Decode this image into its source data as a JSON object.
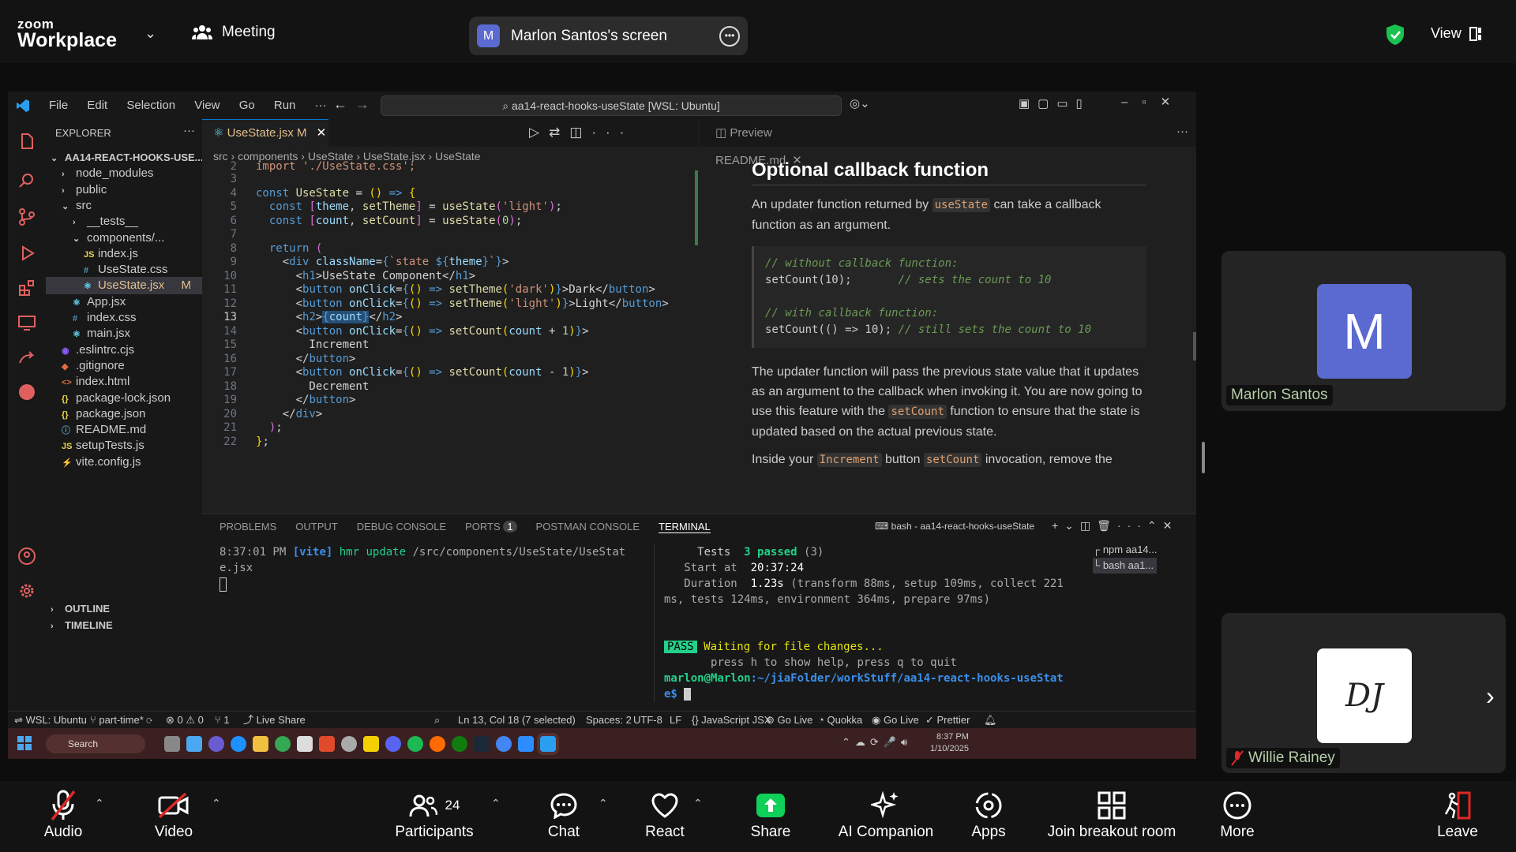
{
  "zoom": {
    "brand_top": "zoom",
    "brand_bottom": "Workplace",
    "meeting_label": "Meeting",
    "share_avatar": "M",
    "share_label": "Marlon Santos's screen",
    "view_label": "View",
    "participants_count": "24",
    "toolbar": {
      "audio": "Audio",
      "video": "Video",
      "participants": "Participants",
      "chat": "Chat",
      "react": "React",
      "share": "Share",
      "ai": "AI Companion",
      "apps": "Apps",
      "breakout": "Join breakout room",
      "more": "More",
      "leave": "Leave"
    },
    "tiles": [
      {
        "name": "Marlon Santos",
        "initial": "M"
      },
      {
        "name": "Willie Rainey",
        "initial": "DJ"
      }
    ],
    "colors": {
      "share_green": "#0fd058",
      "avatar_purple": "#5a6ad0",
      "leave_red": "#e02828"
    }
  },
  "vscode": {
    "menu": [
      "File",
      "Edit",
      "Selection",
      "View",
      "Go",
      "Run",
      "···"
    ],
    "command_center": "aa14-react-hooks-useState [WSL: Ubuntu]",
    "explorer_title": "EXPLORER",
    "tree": [
      {
        "label": "AA14-REACT-HOOKS-USE...",
        "icon": "⌄"
      },
      {
        "label": "node_modules",
        "icon": "›"
      },
      {
        "label": "public",
        "icon": "›"
      },
      {
        "label": "src",
        "icon": "⌄"
      },
      {
        "label": "__tests__",
        "icon": "›"
      },
      {
        "label": "components/...",
        "icon": "⌄"
      },
      {
        "label": "index.js",
        "icon": "JS"
      },
      {
        "label": "UseState.css",
        "icon": "#"
      },
      {
        "label": "UseState.jsx",
        "icon": "⚛",
        "badge": "M"
      },
      {
        "label": "App.jsx",
        "icon": "⚛"
      },
      {
        "label": "index.css",
        "icon": "#"
      },
      {
        "label": "main.jsx",
        "icon": "⚛"
      },
      {
        "label": ".eslintrc.cjs",
        "icon": "◉"
      },
      {
        "label": ".gitignore",
        "icon": "◆"
      },
      {
        "label": "index.html",
        "icon": "<>"
      },
      {
        "label": "package-lock.json",
        "icon": "{}"
      },
      {
        "label": "package.json",
        "icon": "{}"
      },
      {
        "label": "README.md",
        "icon": "ⓘ"
      },
      {
        "label": "setupTests.js",
        "icon": "JS"
      },
      {
        "label": "vite.config.js",
        "icon": "⚡"
      }
    ],
    "outline": "OUTLINE",
    "timeline": "TIMELINE",
    "editor_tab": "UseState.jsx",
    "editor_tab_badge": "M",
    "breadcrumb": [
      "src",
      "components",
      "UseState",
      "UseState.jsx",
      "UseState"
    ],
    "preview_tab": "Preview README.md",
    "preview": {
      "heading": "Optional callback function",
      "p1a": "An updater function returned by ",
      "p1code": "useState",
      "p1b": " can take a callback function as an argument.",
      "code_l1": "// without callback function:",
      "code_l2": "setCount(10);",
      "code_l2c": "// sets the count to 10",
      "code_l3": "// with callback function:",
      "code_l4": "setCount(() => 10);",
      "code_l4c": "// still sets the count to 10",
      "p2a": "The updater function will pass the previous state value that it updates as an argument to the callback when invoking it. You are now going to use this feature with the ",
      "p2code": "setCount",
      "p2b": " function to ensure that the state is updated based on the actual previous state.",
      "p3a": "Inside your ",
      "p3code1": "Increment",
      "p3b": " button ",
      "p3code2": "setCount",
      "p3c": " invocation, remove the"
    },
    "panel_tabs": [
      "PROBLEMS",
      "OUTPUT",
      "DEBUG CONSOLE",
      "PORTS",
      "POSTMAN CONSOLE",
      "TERMINAL"
    ],
    "ports_badge": "1",
    "terminal_title": "bash - aa14-react-hooks-useState",
    "terminal_list": [
      "npm  aa14...",
      "bash  aa1..."
    ],
    "term1": {
      "time": "8:37:01 PM",
      "tag": "[vite]",
      "msg": "hmr update",
      "path": "/src/components/UseState/UseState.jsx"
    },
    "term2": {
      "tests_label": "Tests",
      "tests_val": "3 passed",
      "tests_cnt": "(3)",
      "start_label": "Start at",
      "start_val": "20:37:24",
      "dur_label": "Duration",
      "dur_val": "1.23s",
      "dur_rest": "(transform 88ms, setup 109ms, collect 221",
      "dur_rest2": "ms, tests 124ms, environment 364ms, prepare 97ms)",
      "pass": "PASS",
      "waiting": "Waiting for file changes...",
      "help": "press h to show help, press q to quit",
      "prompt": "marlon@Marlon",
      "cwd": ":~/jiaFolder/workStuff/aa14-react-hooks-useStat",
      "prompt2": "e$"
    },
    "status": {
      "remote": "WSL: Ubuntu",
      "branch": "part-time*",
      "errors": "⊗ 0 ⚠ 0",
      "ports": "⑂ 1",
      "liveshare": "Live Share",
      "position": "Ln 13, Col 18 (7 selected)",
      "spaces": "Spaces: 2",
      "encoding": "UTF-8",
      "eol": "LF",
      "lang": "JavaScript JSX",
      "golive1": "Go Live",
      "quokka": "Quokka",
      "golive2": "Go Live",
      "prettier": "Prettier"
    },
    "taskbar": {
      "search": "Search",
      "time": "8:37 PM",
      "date": "1/10/2025"
    }
  }
}
